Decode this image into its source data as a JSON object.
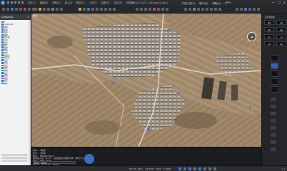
{
  "app": {
    "title": "ZWCAD 2023 - [Drawing1.dwg]",
    "logo_letter": "Z"
  },
  "menu": [
    "文件(F)",
    "编辑(E)",
    "视图(V)",
    "插入(I)",
    "格式(O)",
    "工具(T)",
    "绘图(D)",
    "标注(N)",
    "修改(M)",
    "扩展工具(X)",
    "窗口(W)",
    "帮助(H)",
    "APP+",
    "扩展工具",
    "图层(E)"
  ],
  "window_controls": [
    "—",
    "□",
    "✕"
  ],
  "left_panel": {
    "tab_label": "Drawing1",
    "close_glyph": "✕",
    "items": [
      "0",
      "Defpoints",
      "建筑",
      "道路",
      "水系",
      "植被",
      "等高线",
      "标注",
      "文字",
      "图框",
      "轮廓",
      "地块",
      "边界",
      "控制点",
      "高程点",
      "房屋",
      "围墙",
      "农田",
      "林地",
      "园地",
      "陡坎",
      "桥梁",
      "管线",
      "电力",
      "通信"
    ]
  },
  "viewport": {
    "tab": "模型",
    "compass_label": "N"
  },
  "command": {
    "lines": [
      "命令: *取消*",
      "命令: *取消*",
      "命令: IMAGEATTACH",
      "指定插入点 <0,0>: 指定缩放比例因子或 [单位(U)] <1>:",
      "命令: 缩放 <实时>",
      "按 Esc 或 Enter 键退出"
    ],
    "prompt": "命令: ZOOM"
  },
  "right_panel": {
    "title": "工具选项板",
    "buttons": [
      "建模",
      "注释",
      "建筑",
      "机械",
      "电力",
      "土木",
      "结构",
      "表格"
    ]
  },
  "status": {
    "coords": "452135.6821, 4076254.3390, 0.0000",
    "zoom": "1:1"
  },
  "colors": {
    "accent": "#3a78d8",
    "title_bar": "#2b2d31",
    "viewport_base": "#a88f72"
  }
}
